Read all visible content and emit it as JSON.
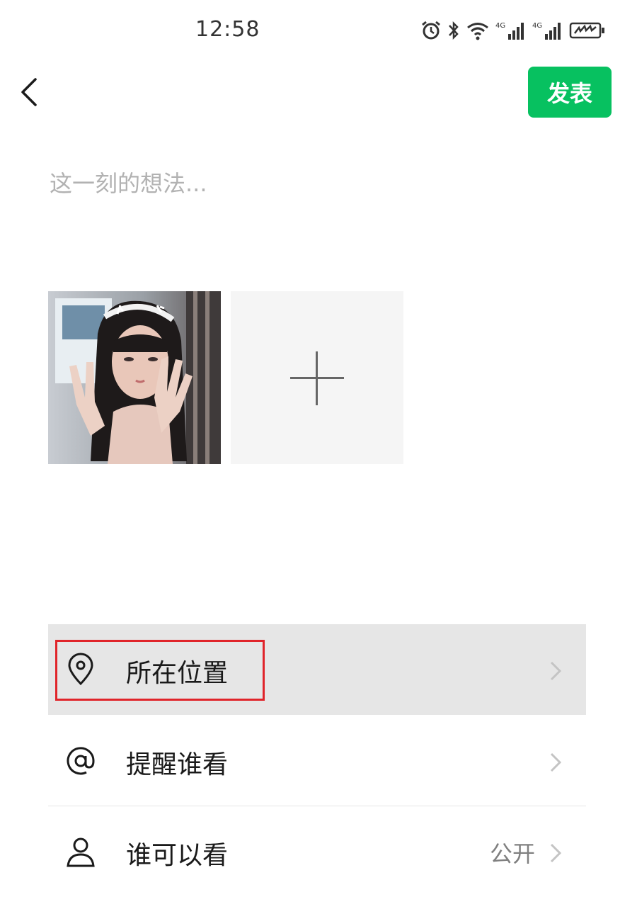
{
  "status_bar": {
    "time": "12:58",
    "icons": [
      "alarm-icon",
      "bluetooth-icon",
      "wifi-icon",
      "signal-4g-icon",
      "signal-4g-icon",
      "battery-charging-icon"
    ],
    "network_label": "4G"
  },
  "header": {
    "back_icon": "back-chevron-icon",
    "post_label": "发表",
    "accent_color": "#07c160"
  },
  "composer": {
    "placeholder": "这一刻的想法...",
    "value": ""
  },
  "media": {
    "photo_count": 1,
    "add_icon": "plus-icon"
  },
  "options": [
    {
      "icon": "location-pin-icon",
      "label": "所在位置",
      "value": ""
    },
    {
      "icon": "at-icon",
      "label": "提醒谁看",
      "value": ""
    },
    {
      "icon": "person-icon",
      "label": "谁可以看",
      "value": "公开"
    }
  ],
  "annotation": {
    "highlight_color": "#e0242a"
  }
}
